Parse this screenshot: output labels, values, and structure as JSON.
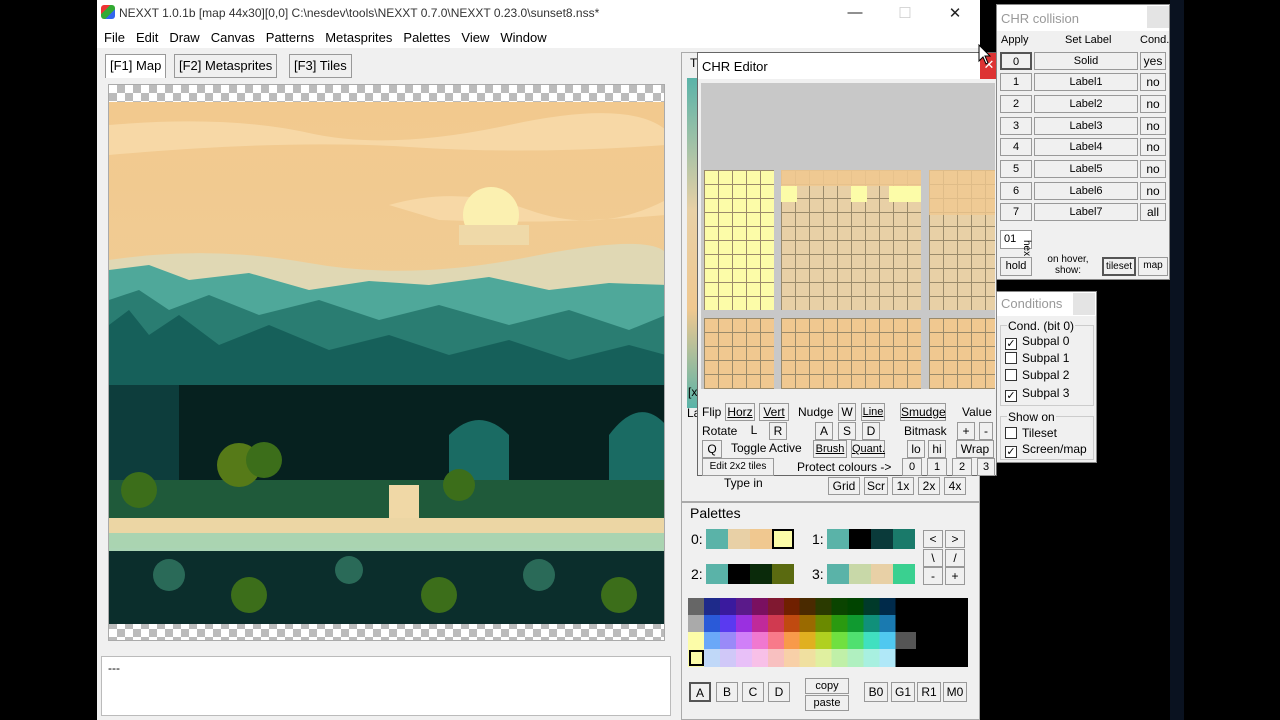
{
  "window": {
    "title": "NEXXT 1.0.1b  [map 44x30][0,0] C:\\nesdev\\tools\\NEXXT 0.7.0\\NEXXT 0.23.0\\sunset8.nss*"
  },
  "menu": [
    "File",
    "Edit",
    "Draw",
    "Canvas",
    "Patterns",
    "Metasprites",
    "Palettes",
    "View",
    "Window"
  ],
  "tabs": [
    "[F1] Map",
    "[F2] Metasprites",
    "[F3] Tiles"
  ],
  "status": {
    "text": "---"
  },
  "chr_editor": {
    "title": "CHR Editor",
    "flip_label": "Flip",
    "horz": "Horz",
    "vert": "Vert",
    "nudge_label": "Nudge",
    "nudge_w": "W",
    "line": "Line",
    "smudge": "Smudge",
    "value_label": "Value",
    "rotate_label": "Rotate",
    "rot_l": "L",
    "rot_r": "R",
    "nudge_a": "A",
    "nudge_s": "S",
    "nudge_d": "D",
    "bitmask_label": "Bitmask",
    "plus": "+",
    "minus": "-",
    "q": "Q",
    "toggle_active": "Toggle Active",
    "brush": "Brush",
    "quant": "Quant.",
    "lo": "lo",
    "hi": "hi",
    "wrap": "Wrap",
    "edit2x2": "Edit 2x2 tiles",
    "protect": "Protect colours ->",
    "protect_nums": [
      "0",
      "1",
      "2",
      "3"
    ]
  },
  "tileset_partial": {
    "t_label": "T",
    "x_label": "[x",
    "la_label": "La",
    "type_in": "Type in",
    "grid": "Grid",
    "scr": "Scr",
    "z1": "1x",
    "z2": "2x",
    "z4": "4x"
  },
  "palettes": {
    "title": "Palettes",
    "sets": [
      {
        "label": "0:",
        "colors": [
          "#5ab3a8",
          "#e8d0a6",
          "#f0c890",
          "#fcfca8"
        ]
      },
      {
        "label": "1:",
        "colors": [
          "#5ab3a8",
          "#000000",
          "#0a3a3a",
          "#1a7a6a"
        ]
      },
      {
        "label": "2:",
        "colors": [
          "#5ab3a8",
          "#000000",
          "#0a2a0a",
          "#5a6a10"
        ]
      },
      {
        "label": "3:",
        "colors": [
          "#5ab3a8",
          "#c8d8a8",
          "#e8d0a6",
          "#3ad090"
        ]
      }
    ],
    "arrows": [
      "<",
      ">",
      "\\",
      "/",
      "-",
      "+"
    ],
    "subpal_buttons": [
      "A",
      "B",
      "C",
      "D"
    ],
    "copy": "copy",
    "paste": "paste",
    "bank_buttons": [
      "B0",
      "G1",
      "R1",
      "M0"
    ]
  },
  "chr_collision": {
    "title": "CHR collision",
    "headers": [
      "Apply",
      "Set Label",
      "Cond."
    ],
    "rows": [
      {
        "n": "0",
        "label": "Solid",
        "cond": "yes"
      },
      {
        "n": "1",
        "label": "Label1",
        "cond": "no"
      },
      {
        "n": "2",
        "label": "Label2",
        "cond": "no"
      },
      {
        "n": "3",
        "label": "Label3",
        "cond": "no"
      },
      {
        "n": "4",
        "label": "Label4",
        "cond": "no"
      },
      {
        "n": "5",
        "label": "Label5",
        "cond": "no"
      },
      {
        "n": "6",
        "label": "Label6",
        "cond": "no"
      },
      {
        "n": "7",
        "label": "Label7",
        "cond": "all"
      }
    ],
    "hex_value": "01",
    "hex_label": "hex",
    "hold": "hold",
    "on_hover": "on hover, show:",
    "tileset": "tileset",
    "map": "map"
  },
  "conditions": {
    "title": "Conditions",
    "group1": "Cond. (bit 0)",
    "subpals": [
      {
        "label": "Subpal 0",
        "checked": true
      },
      {
        "label": "Subpal 1",
        "checked": false
      },
      {
        "label": "Subpal 2",
        "checked": false
      },
      {
        "label": "Subpal 3",
        "checked": true
      }
    ],
    "group2": "Show on",
    "show": [
      {
        "label": "Tileset",
        "checked": false
      },
      {
        "label": "Screen/map",
        "checked": true
      }
    ]
  }
}
